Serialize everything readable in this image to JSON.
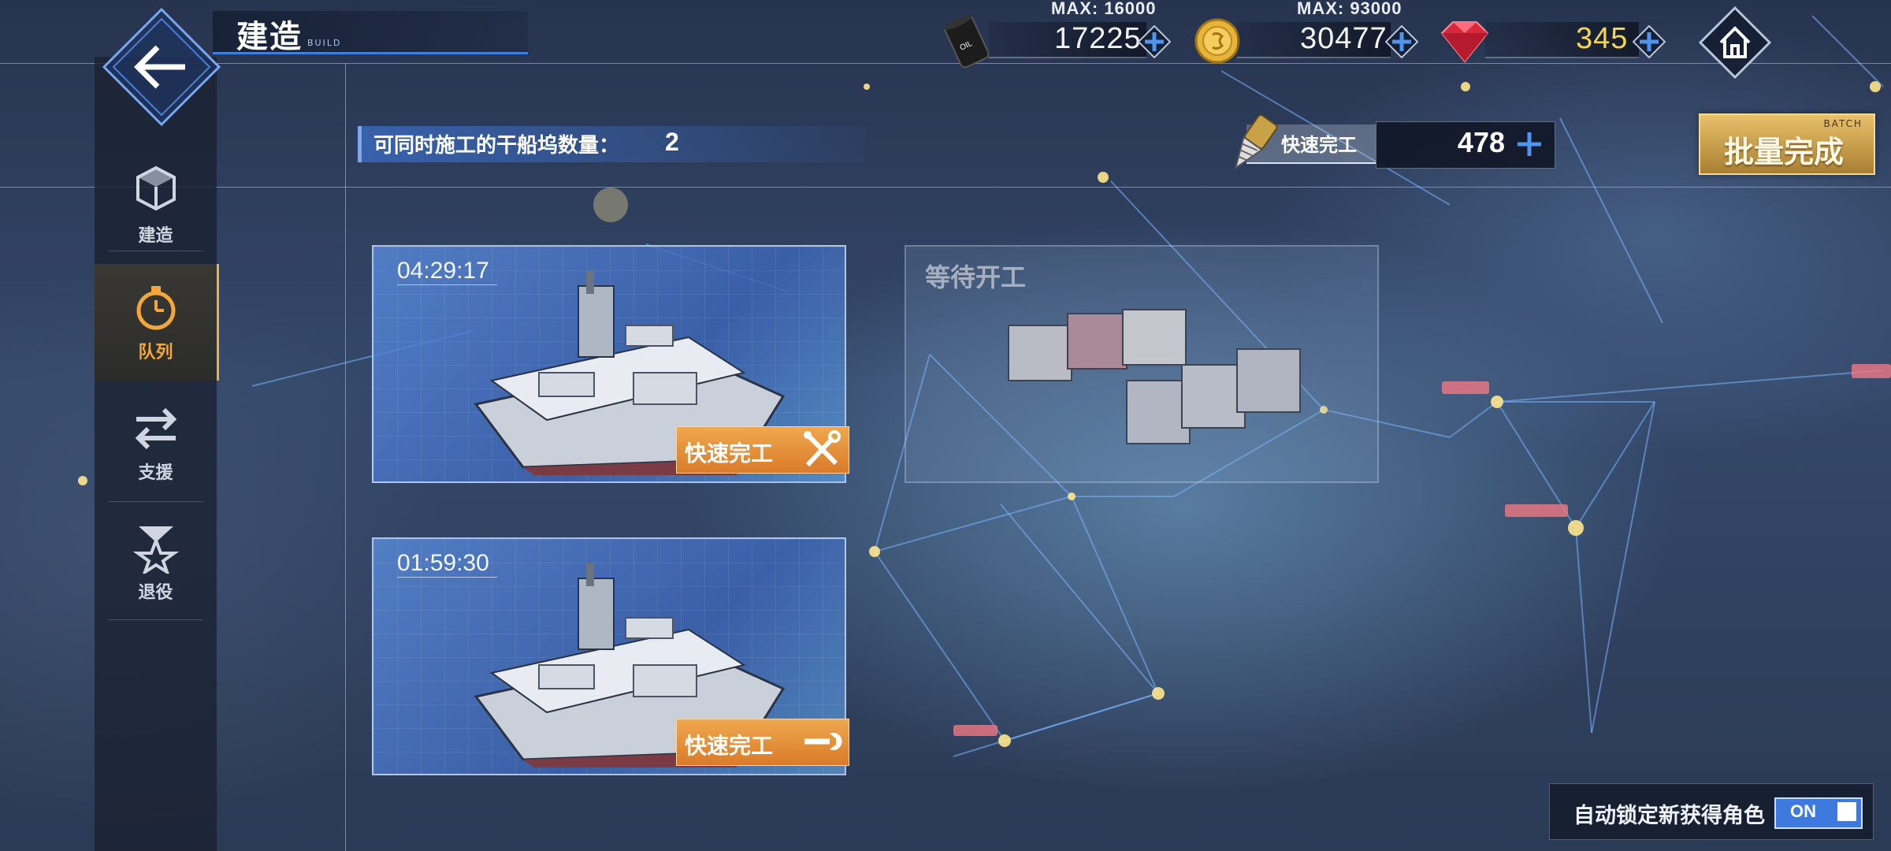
{
  "header": {
    "title": "建造",
    "subtitle": "BUILD"
  },
  "resources": {
    "oil": {
      "max_label": "MAX: 16000",
      "value": "17225",
      "icon": "oil-barrel-icon"
    },
    "coin": {
      "max_label": "MAX: 93000",
      "value": "30477",
      "icon": "gold-coin-icon"
    },
    "gem": {
      "value": "345",
      "icon": "red-gem-icon",
      "color": "#f4d64e"
    }
  },
  "sidebar": {
    "items": [
      {
        "label": "建造",
        "icon": "build-box-icon",
        "active": false
      },
      {
        "label": "队列",
        "icon": "stopwatch-icon",
        "active": true
      },
      {
        "label": "支援",
        "icon": "swap-arrows-icon",
        "active": false
      },
      {
        "label": "退役",
        "icon": "retire-star-icon",
        "active": false
      }
    ]
  },
  "dock_info": {
    "label": "可同时施工的干船坞数量：",
    "count": "2"
  },
  "quick_finish": {
    "label": "快速完工",
    "count": "478",
    "icon": "drill-icon"
  },
  "batch": {
    "small": "BATCH",
    "label": "批量完成"
  },
  "docks": [
    {
      "timer": "04:29:17",
      "button": "快速完工",
      "button_icon": "wrench-screwdriver-icon"
    },
    {
      "timer": "01:59:30",
      "button": "快速完工",
      "button_icon": "wrench-icon"
    }
  ],
  "waiting": {
    "label": "等待开工"
  },
  "autolock": {
    "label": "自动锁定新获得角色",
    "toggle": "ON"
  },
  "colors": {
    "accent_blue": "#3d79df",
    "active_orange": "#f3a73a",
    "button_orange": "#e08a34",
    "batch_gold": "#d6ac55"
  }
}
